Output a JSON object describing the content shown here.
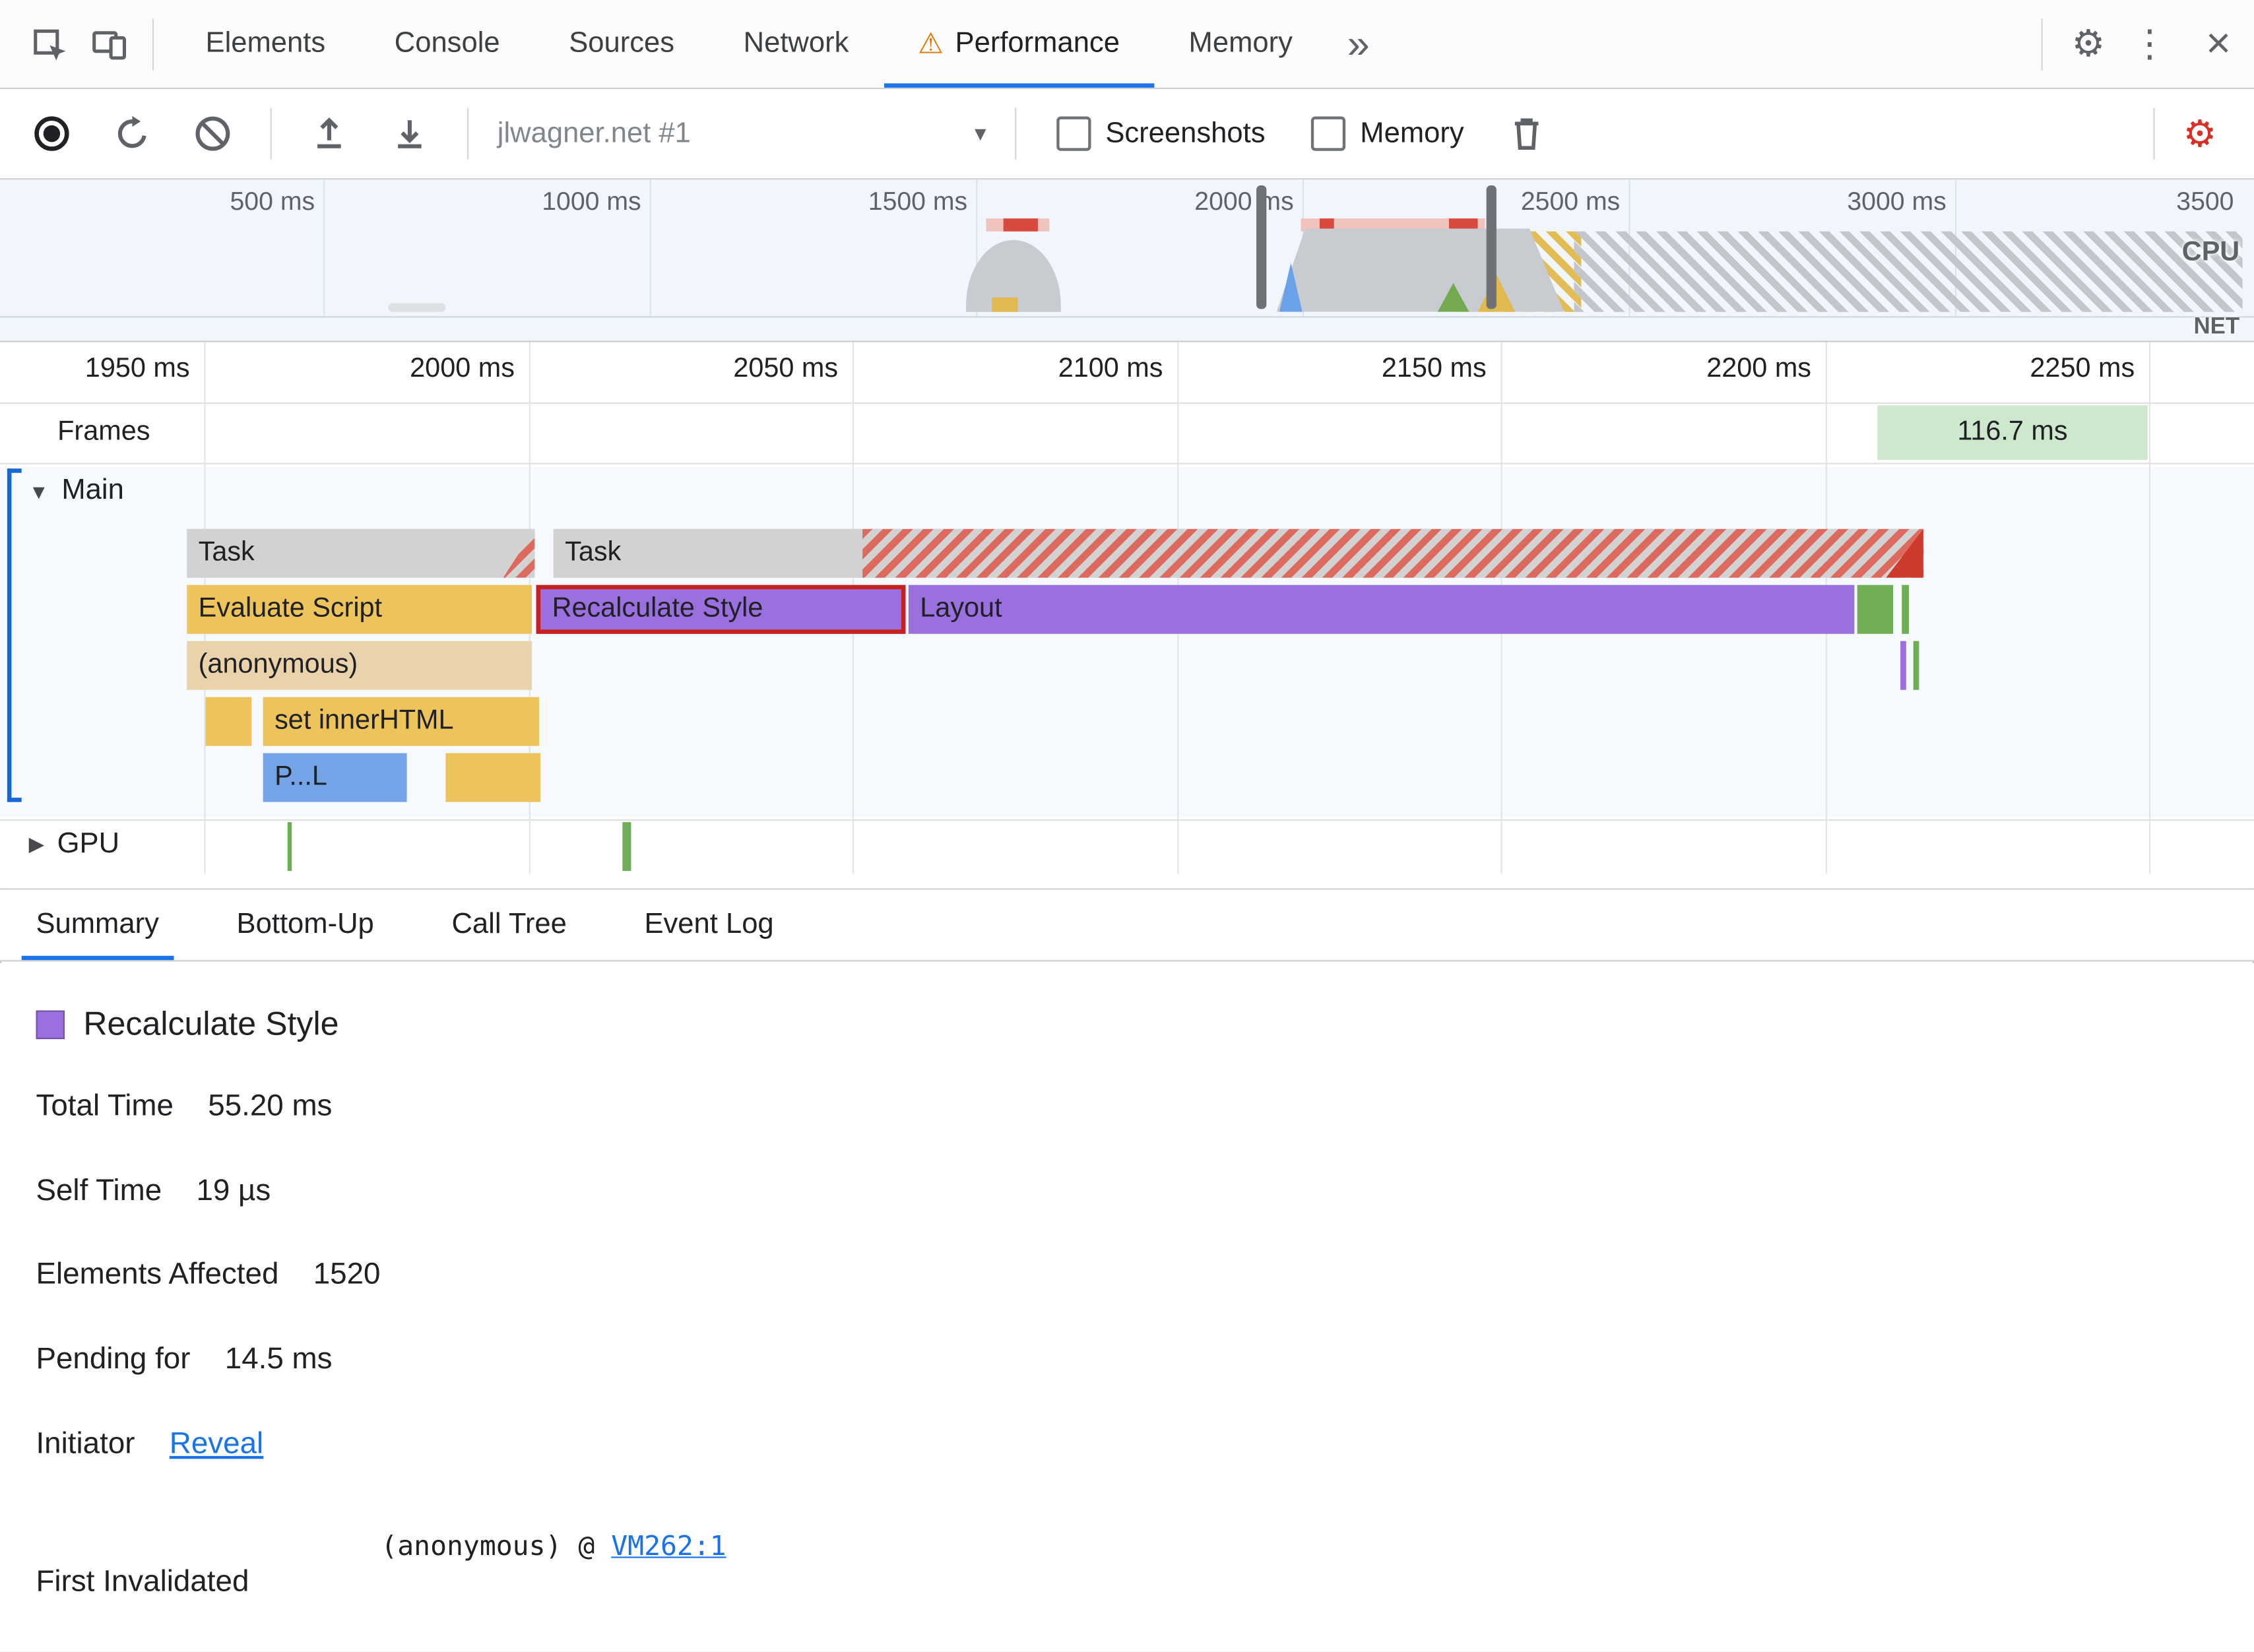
{
  "colors": {
    "accent": "#1a73e8",
    "scripting": "#edc35c",
    "rendering": "#9a6fde",
    "painting": "#6fae57",
    "task": "#d2d2d2",
    "anon": "#ead2ab",
    "parse": "#74a3e8",
    "warning": "#e37400",
    "selection-red": "#c5221f",
    "frame-green-bg": "#cde8cd",
    "link": "#1a73e8"
  },
  "icons": {
    "warning": "⚠",
    "overflow": "»",
    "gear": "⚙",
    "dots": "⋮",
    "close": "×",
    "dropdown": "▾",
    "main_arrow": "▼",
    "gpu_arrow": "▶"
  },
  "tabbar": {
    "tabs": [
      {
        "label": "Elements"
      },
      {
        "label": "Console"
      },
      {
        "label": "Sources"
      },
      {
        "label": "Network"
      },
      {
        "label": "Performance"
      },
      {
        "label": "Memory"
      }
    ]
  },
  "toolbar": {
    "session": "jlwagner.net #1",
    "screenshots": "Screenshots",
    "memory": "Memory"
  },
  "overview": {
    "ticks": [
      "500 ms",
      "1000 ms",
      "1500 ms",
      "2000 ms",
      "2500 ms",
      "3000 ms",
      "3500"
    ],
    "cpu": "CPU",
    "net": "NET"
  },
  "timeline": {
    "ticks": [
      "1950 ms",
      "2000 ms",
      "2050 ms",
      "2100 ms",
      "2150 ms",
      "2200 ms",
      "2250 ms"
    ],
    "frames_label": "Frames",
    "frame_duration": "116.7 ms",
    "main_label": "Main",
    "gpu_label": "GPU",
    "bars": {
      "task1": "Task",
      "task2": "Task",
      "evaluate_script": "Evaluate Script",
      "recalc_style": "Recalculate Style",
      "layout": "Layout",
      "anonymous": "(anonymous)",
      "set_inner_html": "set innerHTML",
      "parse_truncated": "P...L"
    }
  },
  "bottom_tabs": [
    {
      "label": "Summary"
    },
    {
      "label": "Bottom-Up"
    },
    {
      "label": "Call Tree"
    },
    {
      "label": "Event Log"
    }
  ],
  "summary": {
    "title": "Recalculate Style",
    "rows": [
      {
        "label": "Total Time",
        "value": "55.20 ms"
      },
      {
        "label": "Self Time",
        "value": "19 µs"
      },
      {
        "label": "Elements Affected",
        "value": "1520"
      },
      {
        "label": "Pending for",
        "value": "14.5 ms"
      }
    ],
    "initiator_label": "Initiator",
    "initiator_link": "Reveal",
    "first_invalidated_label": "First Invalidated",
    "stack_prefix": "(anonymous) @ ",
    "stack_link": "VM262:1"
  }
}
